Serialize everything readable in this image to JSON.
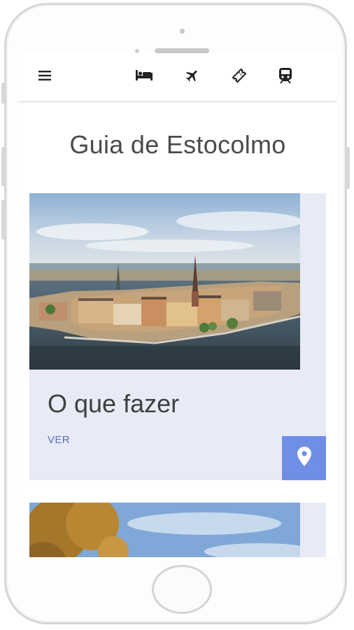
{
  "header": {
    "menu_icon": "hamburger-menu-icon",
    "nav_icons": [
      "bed-icon",
      "airplane-icon",
      "ticket-icon",
      "train-icon"
    ]
  },
  "page": {
    "title": "Guia de Estocolmo"
  },
  "cards": [
    {
      "image": "stockholm-aerial-photo",
      "title": "O que fazer",
      "link_label": "VER",
      "action_icon": "location-pin-icon"
    },
    {
      "image": "autumn-tree-building-photo"
    }
  ],
  "colors": {
    "card_background": "#e8ebf5",
    "accent": "#6f8ee6",
    "link": "#5a6fb6",
    "title_text": "#4a4a4a"
  }
}
